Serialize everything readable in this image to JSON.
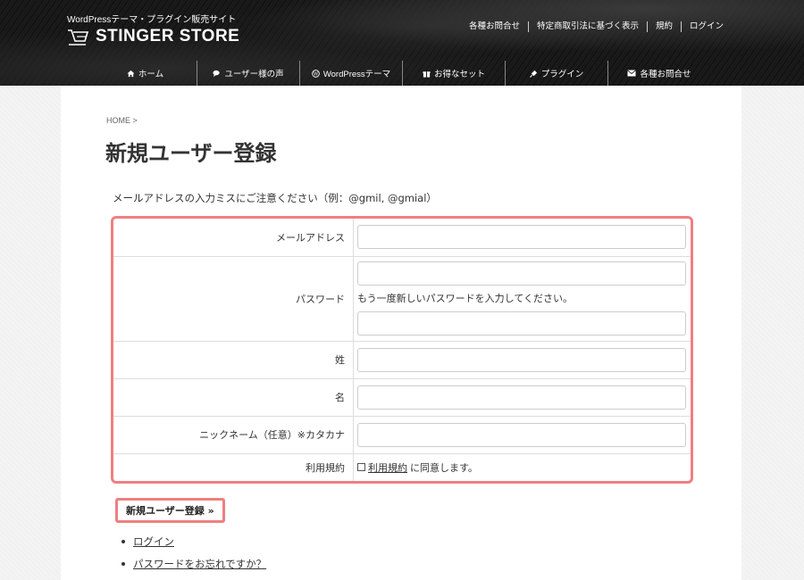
{
  "header": {
    "tagline": "WordPressテーマ・プラグイン販売サイト",
    "logo_text": "STINGER STORE",
    "top_links": [
      "各種お問合せ",
      "特定商取引法に基づく表示",
      "規約",
      "ログイン"
    ]
  },
  "nav": {
    "items": [
      {
        "label": "ホーム",
        "icon": "home-icon"
      },
      {
        "label": "ユーザー様の声",
        "icon": "comments-icon"
      },
      {
        "label": "WordPressテーマ",
        "icon": "wordpress-icon"
      },
      {
        "label": "お得なセット",
        "icon": "gift-icon"
      },
      {
        "label": "プラグイン",
        "icon": "plug-icon"
      },
      {
        "label": "各種お問合せ",
        "icon": "envelope-icon"
      }
    ]
  },
  "breadcrumb": "HOME >",
  "page_title": "新規ユーザー登録",
  "notice": "メールアドレスの入力ミスにご注意ください（例：@gmil, @gmial）",
  "form": {
    "email_label": "メールアドレス",
    "password_label": "パスワード",
    "password_confirm_note": "もう一度新しいパスワードを入力してください。",
    "lastname_label": "姓",
    "firstname_label": "名",
    "nickname_label": "ニックネーム（任意）※カタカナ",
    "terms_label": "利用規約",
    "terms_link": "利用規約",
    "terms_agree_suffix": "に同意します。",
    "email_value": "",
    "password_value": "",
    "password_confirm_value": "",
    "lastname_value": "",
    "firstname_value": "",
    "nickname_value": ""
  },
  "submit_label": "新規ユーザー登録 »",
  "links": [
    "ログイン",
    "パスワードをお忘れですか？"
  ],
  "colors": {
    "accent_border": "#ef7f80",
    "header_bg": "#111111"
  }
}
